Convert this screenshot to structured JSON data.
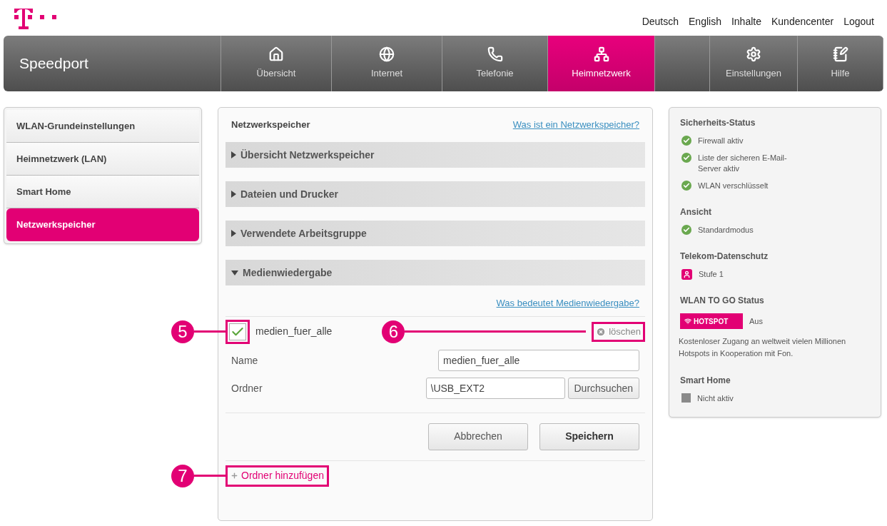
{
  "header_links": [
    "Deutsch",
    "English",
    "Inhalte",
    "Kundencenter",
    "Logout"
  ],
  "nav": {
    "brand": "Speedport",
    "tabs": [
      {
        "label": "Übersicht",
        "selected": false
      },
      {
        "label": "Internet",
        "selected": false
      },
      {
        "label": "Telefonie",
        "selected": false
      },
      {
        "label": "Heimnetzwerk",
        "selected": true
      },
      {
        "label": "Einstellungen",
        "selected": false
      },
      {
        "label": "Hilfe",
        "selected": false
      }
    ]
  },
  "sidebar": {
    "items": [
      {
        "label": "WLAN-Grundeinstellungen",
        "selected": false
      },
      {
        "label": "Heimnetzwerk (LAN)",
        "selected": false
      },
      {
        "label": "Smart Home",
        "selected": false
      },
      {
        "label": "Netzwerkspeicher",
        "selected": true
      }
    ]
  },
  "main": {
    "title": "Netzwerkspeicher",
    "help_link": "Was ist ein Netzwerkspeicher?",
    "sections": [
      {
        "label": "Übersicht Netzwerkspeicher",
        "expanded": false
      },
      {
        "label": "Dateien und Drucker",
        "expanded": false
      },
      {
        "label": "Verwendete Arbeitsgruppe",
        "expanded": false
      },
      {
        "label": "Medienwiedergabe",
        "expanded": true
      }
    ],
    "media": {
      "help_link": "Was bedeutet Medienwiedergabe?",
      "share": {
        "name": "medien_fuer_alle",
        "checked": true,
        "callout": "5"
      },
      "delete": {
        "label": "löschen",
        "callout": "6"
      },
      "fields": [
        {
          "label": "Name",
          "value": "medien_fuer_alle"
        },
        {
          "label": "Ordner",
          "value": "\\USB_EXT2",
          "button": "Durchsuchen"
        }
      ],
      "buttons": [
        {
          "label": "Abbrechen",
          "kind": "secondary"
        },
        {
          "label": "Speichern",
          "kind": "primary"
        }
      ],
      "add_folder": {
        "label": "Ordner hinzufügen",
        "callout": "7"
      }
    }
  },
  "status_panel": {
    "sections": [
      {
        "title": "Sicherheits-Status",
        "items": [
          {
            "kind": "ok",
            "text": "Firewall aktiv"
          },
          {
            "kind": "ok",
            "text": "Liste der sicheren E-Mail-Server aktiv"
          },
          {
            "kind": "ok",
            "text": "WLAN verschlüsselt"
          }
        ]
      },
      {
        "title": "Ansicht",
        "items": [
          {
            "kind": "ok",
            "text": "Standardmodus"
          }
        ]
      },
      {
        "title": "Telekom-Datenschutz",
        "items": [
          {
            "kind": "privacy",
            "text": "Stufe 1"
          }
        ]
      },
      {
        "title": "WLAN TO GO Status",
        "hotspot": {
          "badge": "HOTSPOT",
          "state": "Aus"
        },
        "description": "Kostenloser Zugang an weltweit vielen Millionen Hotspots in Kooperation mit Fon."
      },
      {
        "title": "Smart Home",
        "items": [
          {
            "kind": "inactive",
            "text": "Nicht aktiv"
          }
        ]
      }
    ]
  }
}
